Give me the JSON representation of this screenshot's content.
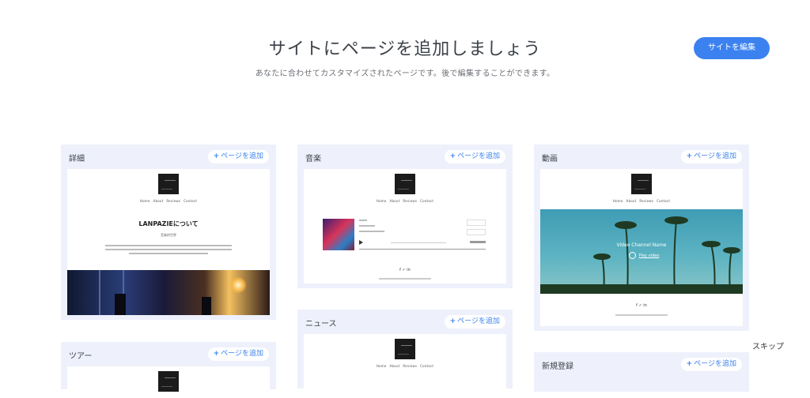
{
  "header": {
    "title": "サイトにページを追加しましょう",
    "subtitle": "あなたに合わせてカスタマイズされたページです。後で編集することができます。",
    "edit_button": "サイトを編集"
  },
  "skip": "スキップ",
  "add_page_label": "ページを追加",
  "cards": {
    "details": {
      "title": "詳細",
      "nav": [
        "Home",
        "About",
        "Reviews",
        "Contact"
      ],
      "heading": "LANPAZIEについて",
      "subheading": "音楽的世界"
    },
    "music": {
      "title": "音楽",
      "nav": [
        "Home",
        "About",
        "Reviews",
        "Contact"
      ],
      "social": "f ✓ in"
    },
    "video": {
      "title": "動画",
      "nav": [
        "Home",
        "About",
        "Reviews",
        "Contact"
      ],
      "channel_name": "Video Channel Name",
      "play_label": "Play video",
      "social": "f ✓ in"
    },
    "news": {
      "title": "ニュース",
      "nav": [
        "Home",
        "About",
        "Reviews",
        "Contact"
      ]
    },
    "tour": {
      "title": "ツアー"
    },
    "signup": {
      "title": "新規登録"
    }
  },
  "colors": {
    "accent": "#3b82f0",
    "card_bg": "#eef1fb",
    "video_sky": "#4fa8b8"
  }
}
